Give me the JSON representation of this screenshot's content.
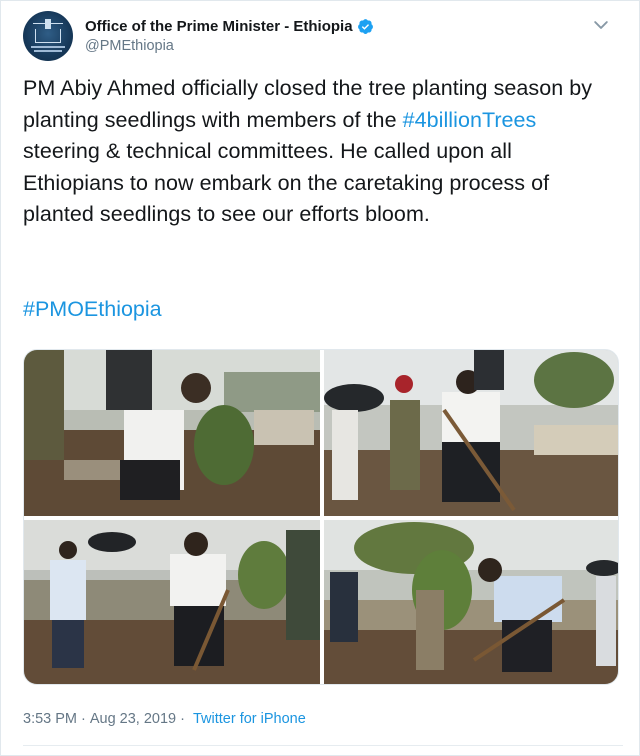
{
  "author": {
    "display_name": "Office of the Prime Minister - Ethiopia",
    "handle": "@PMEthiopia",
    "verified_color": "#1da1f2"
  },
  "tweet": {
    "text_before_tag": "PM Abiy Ahmed officially closed the tree planting season by planting seedlings with members of the ",
    "hashtag_inline": "#4billionTrees",
    "text_after_tag": " steering & technical committees. He called upon all Ethiopians to now embark on the caretaking process of planted seedlings to see our efforts bloom.",
    "hashtag_footer": "#PMOEthiopia",
    "link_color": "#1b95e0"
  },
  "meta": {
    "time": "3:53 PM",
    "separator": "·",
    "date": "Aug 23, 2019",
    "source": "Twitter for iPhone"
  },
  "icons": [
    "avatar-logo",
    "verified-badge-icon",
    "chevron-down-icon"
  ]
}
